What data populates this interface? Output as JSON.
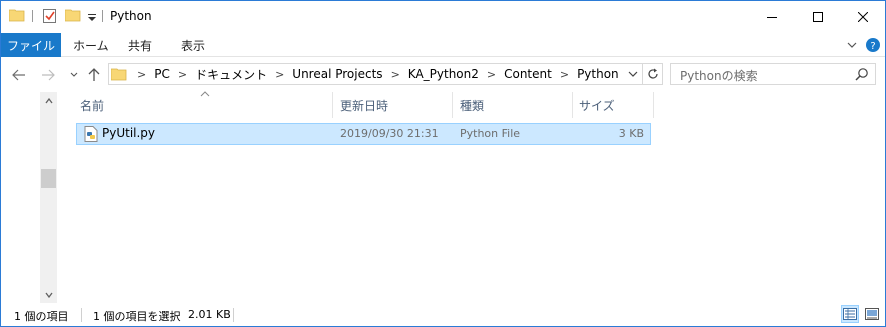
{
  "titlebar": {
    "title": "Python",
    "quick_access": [
      "folder-icon",
      "properties-check-icon",
      "new-folder-icon",
      "customize-dropdown-icon"
    ],
    "buttons": [
      "minimize-icon",
      "maximize-icon",
      "close-icon"
    ]
  },
  "ribbon": {
    "file_tab": "ファイル",
    "tabs": [
      "ホーム",
      "共有",
      "表示"
    ],
    "accent_color": "#1979ca"
  },
  "address": {
    "crumbs": [
      "PC",
      "ドキュメント",
      "Unreal Projects",
      "KA_Python2",
      "Content",
      "Python"
    ],
    "search_placeholder": "Pythonの検索"
  },
  "columns": {
    "name": "名前",
    "date": "更新日時",
    "type": "種類",
    "size": "サイズ"
  },
  "files": [
    {
      "name": "PyUtil.py",
      "date": "2019/09/30 21:31",
      "type": "Python File",
      "size": "3 KB",
      "selected": true
    }
  ],
  "status": {
    "item_count": "1 個の項目",
    "selected": "1 個の項目を選択",
    "selected_size": "2.01 KB"
  }
}
